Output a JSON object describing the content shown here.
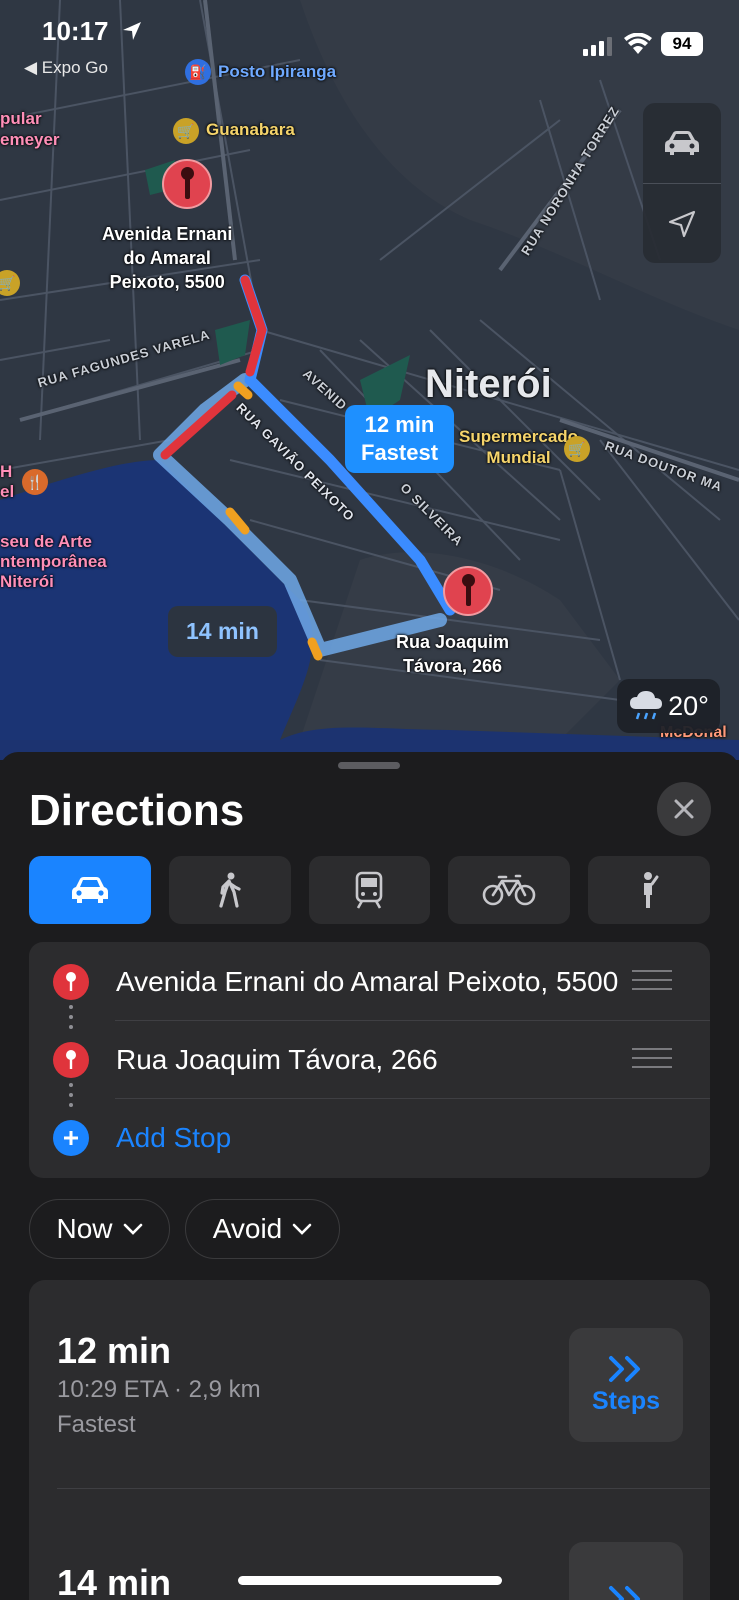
{
  "status_bar": {
    "time": "10:17",
    "back_app": "◀ Expo Go",
    "battery": "94"
  },
  "map": {
    "city": "Niterói",
    "pois": {
      "posto": "Posto Ipiranga",
      "guanabara": "Guanabara",
      "supermercado": "Supermercado\nMundial",
      "popular": "pular\nemeyer",
      "museu": "seu de Arte\nntemporânea\nNiterói",
      "hotel": "H\nel",
      "mcdonalds": "McDonal"
    },
    "streets": {
      "fagundes": "RUA FAGUNDES VARELA",
      "gaviao": "RUA GAVIÃO PEIXOTO",
      "noronha": "RUA NORONHA TORREZ",
      "doutor": "RUA DOUTOR MA",
      "avenida": "AVENID",
      "silveira": "O SILVEIRA"
    },
    "origin_label": "Avenida Ernani\ndo Amaral\nPeixoto, 5500",
    "dest_label": "Rua Joaquim\nTávora, 266",
    "selected_route_bubble": {
      "time": "12 min",
      "label": "Fastest"
    },
    "alt_route_bubble": "14 min",
    "weather": "20°",
    "colors": {
      "route_main": "#3b8cff",
      "route_alt": "#6fa8e8",
      "traffic_heavy": "#e0343c",
      "traffic_mid": "#f0a020",
      "water": "#1b3474"
    }
  },
  "sheet": {
    "title": "Directions",
    "modes": [
      "car-icon",
      "walk-icon",
      "transit-icon",
      "bike-icon",
      "rideshare-icon"
    ],
    "stops": [
      {
        "text": "Avenida Ernani do Amaral Peixoto, 5500"
      },
      {
        "text": "Rua Joaquim Távora, 266"
      }
    ],
    "add_stop": "Add Stop",
    "chips": {
      "now": "Now",
      "avoid": "Avoid"
    },
    "routes": [
      {
        "duration": "12 min",
        "meta": "10:29 ETA · 2,9 km",
        "sub": "Fastest",
        "steps_label": "Steps"
      },
      {
        "duration": "14 min"
      }
    ]
  }
}
